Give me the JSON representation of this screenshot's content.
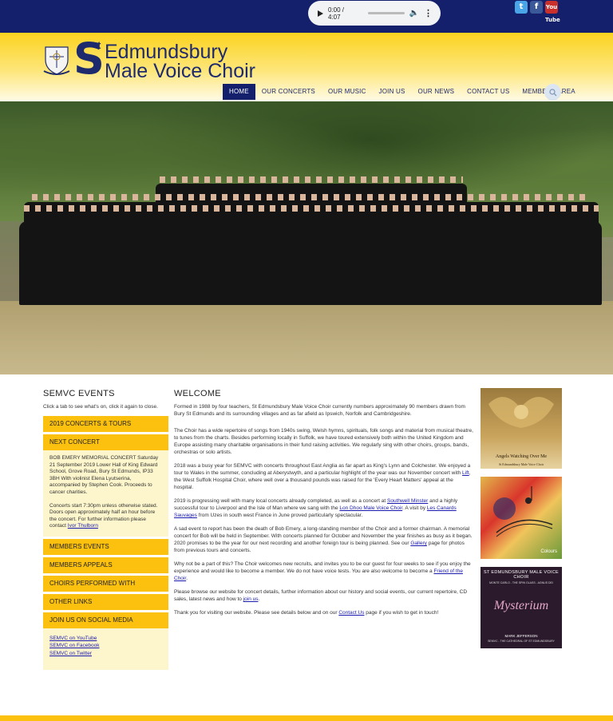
{
  "audio": {
    "time": "0:00 / 4:07"
  },
  "social": {
    "twitter": "t",
    "facebook": "f",
    "youtube": "You Tube"
  },
  "logo": {
    "st_big": "S",
    "st_small": "t",
    "line1": "Edmundsbury",
    "line2": "Male Voice Choir"
  },
  "nav": [
    "HOME",
    "OUR CONCERTS",
    "OUR MUSIC",
    "JOIN US",
    "OUR NEWS",
    "CONTACT US",
    "MEMBERS AREA"
  ],
  "events": {
    "title": "SEMVC EVENTS",
    "intro": "Click a tab to see what's on, click it again to close.",
    "tabs": [
      "2019 CONCERTS & TOURS",
      "NEXT CONCERT",
      "MEMBERS EVENTS",
      "MEMBERS APPEALS",
      "CHOIRS PERFORMED WITH",
      "OTHER LINKS",
      "JOIN US ON SOCIAL MEDIA"
    ],
    "next_concert": {
      "p1": "BOB EMERY MEMORIAL CONCERT Saturday 21 September 2019 Lower Hall of King Edward School, Grove Road, Bury St Edmunds, IP33 3BH With violinist Elena Lyutserina, accompanied by Stephen Cook. Proceeds to cancer charities.",
      "p2": "Concerts start 7:30pm unless otherwise stated. Doors open approximately half an hour before the concert. For further information please contact ",
      "contact": "Ivor Thulborn"
    },
    "social_links": [
      "SEMVC on YouTube",
      "SEMVC on Facebook",
      "SEMVC on Twitter"
    ]
  },
  "welcome": {
    "title": "WELCOME",
    "p1": "Formed in 1988 by four teachers, St Edmundsbury Male Voice Choir currently numbers approximately 90 members drawn from Bury St Edmunds and its surrounding villages and as far afield as Ipswich, Norfolk and Cambridgeshire.",
    "p2": "The Choir has a wide repertoire of songs from 1940s swing, Welsh hymns, spirituals, folk songs and material from musical theatre, to tunes from the charts. Besides performing locally in Suffolk, we have toured extensively both within the United Kingdom and Europe assisting many charitable organisations in their fund raising activities. We regularly sing with other choirs, groups, bands, orchestras or solo artists.",
    "p3a": "2018 was a busy year for SEMVC with concerts throughout East Anglia as far apart as King's Lynn and Colchester. We enjoyed a tour to Wales in the summer, concluding at Aberystwyth, and a particular highlight of the year was our November concert with ",
    "p3link": "Lift",
    "p3b": ", the West Suffolk Hospital Choir, where well over a thousand pounds was raised for the 'Every Heart Matters' appeal at the hospital.",
    "p4a": "2019 is progressing well with many local concerts already completed, as well as a concert at ",
    "p4link1": "Southwell Minster",
    "p4b": " and a highly successful tour to Liverpool and the Isle of Man where we sang with the ",
    "p4link2": "Lon Dhoo Male Voice Choir",
    "p4c": ". A visit by ",
    "p4link3": "Les Canards Sauvages",
    "p4d": " from Uzes in south west France in June proved particularly spectacular.",
    "p5a": "A sad event to report has been the death of Bob Emery, a long-standing member of the Choir and a former chairman. A memorial concert for Bob will be held in September. With concerts planned for October and November the year finishes as busy as it began. 2020 promises to be the year for our next recording and another foreign tour is being planned. See our ",
    "p5link": "Gallery",
    "p5b": " page for photos from previous tours and concerts.",
    "p6a": "Why not be a part of this? The Choir welcomes new recruits, and invites you to be our guest for four weeks to see if you enjoy the experience and would like to become a member. We do not have voice tests. You are also welcome to become a ",
    "p6link": "Friend of the Choir",
    "p6b": ".",
    "p7a": "Please browse our website for concert details, further information about our history and social events, our current repertoire, CD sales, latest news and how to ",
    "p7link": "join us",
    "p7b": ".",
    "p8a": "Thank you for visiting our website. Please see details below and on our ",
    "p8link": "Contact Us",
    "p8b": " page if you wish to get in touch!"
  },
  "cds": {
    "cd1_title": "Angels Watching Over Me",
    "cd1_sub": "St Edmundsbury Male Voice Choir",
    "cd2_label": "Colours",
    "cd3_header": "ST EDMUNDSBURY MALE VOICE CHOIR",
    "cd3_sub": "MONTE CARLO - THE SPIN GLASS - AGNUS DEI",
    "cd3_title": "Mysterium",
    "cd3_conductor": "MARK JEFFERSON",
    "cd3_footer": "SEMVC - THE CATHEDRAL OF ST EDMUNDSBURY"
  }
}
